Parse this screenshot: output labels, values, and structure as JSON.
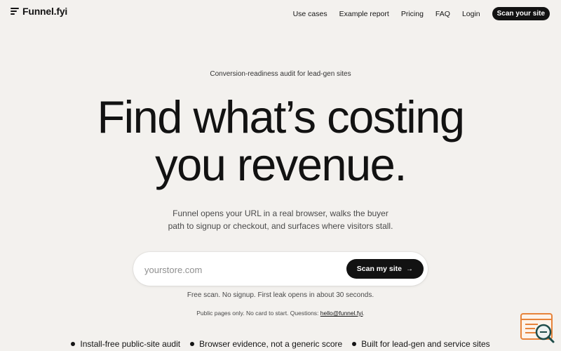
{
  "header": {
    "logo_text": "Funnel.fyi",
    "nav_links": [
      "Use cases",
      "Example report",
      "Pricing",
      "FAQ",
      "Login"
    ],
    "cta_label": "Scan your site"
  },
  "hero": {
    "eyebrow": "Conversion-readiness audit for lead-gen sites",
    "headline_line1": "Find what’s costing",
    "headline_line2": "you revenue.",
    "subhead_line1": "Funnel opens your URL in a real browser, walks the buyer",
    "subhead_line2": "path to signup or checkout, and surfaces where visitors stall."
  },
  "scan_form": {
    "placeholder": "yourstore.com",
    "value": "",
    "button_label": "Scan my site",
    "button_icon": "arrow-right-icon"
  },
  "notes": {
    "line1": "Free scan. No signup. First leak opens in about 30 seconds.",
    "line2_prefix": "Public pages only. No card to start. Questions: ",
    "email": "hello@funnel.fyi",
    "line2_suffix": "."
  },
  "features": [
    "Install-free public-site audit",
    "Browser evidence, not a generic score",
    "Built for lead-gen and service sites"
  ],
  "widget": {
    "icon": "chat-search-icon"
  },
  "colors": {
    "background": "#f3f1ee",
    "text": "#141414",
    "button": "#121212",
    "widget_accent": "#e7833a"
  }
}
